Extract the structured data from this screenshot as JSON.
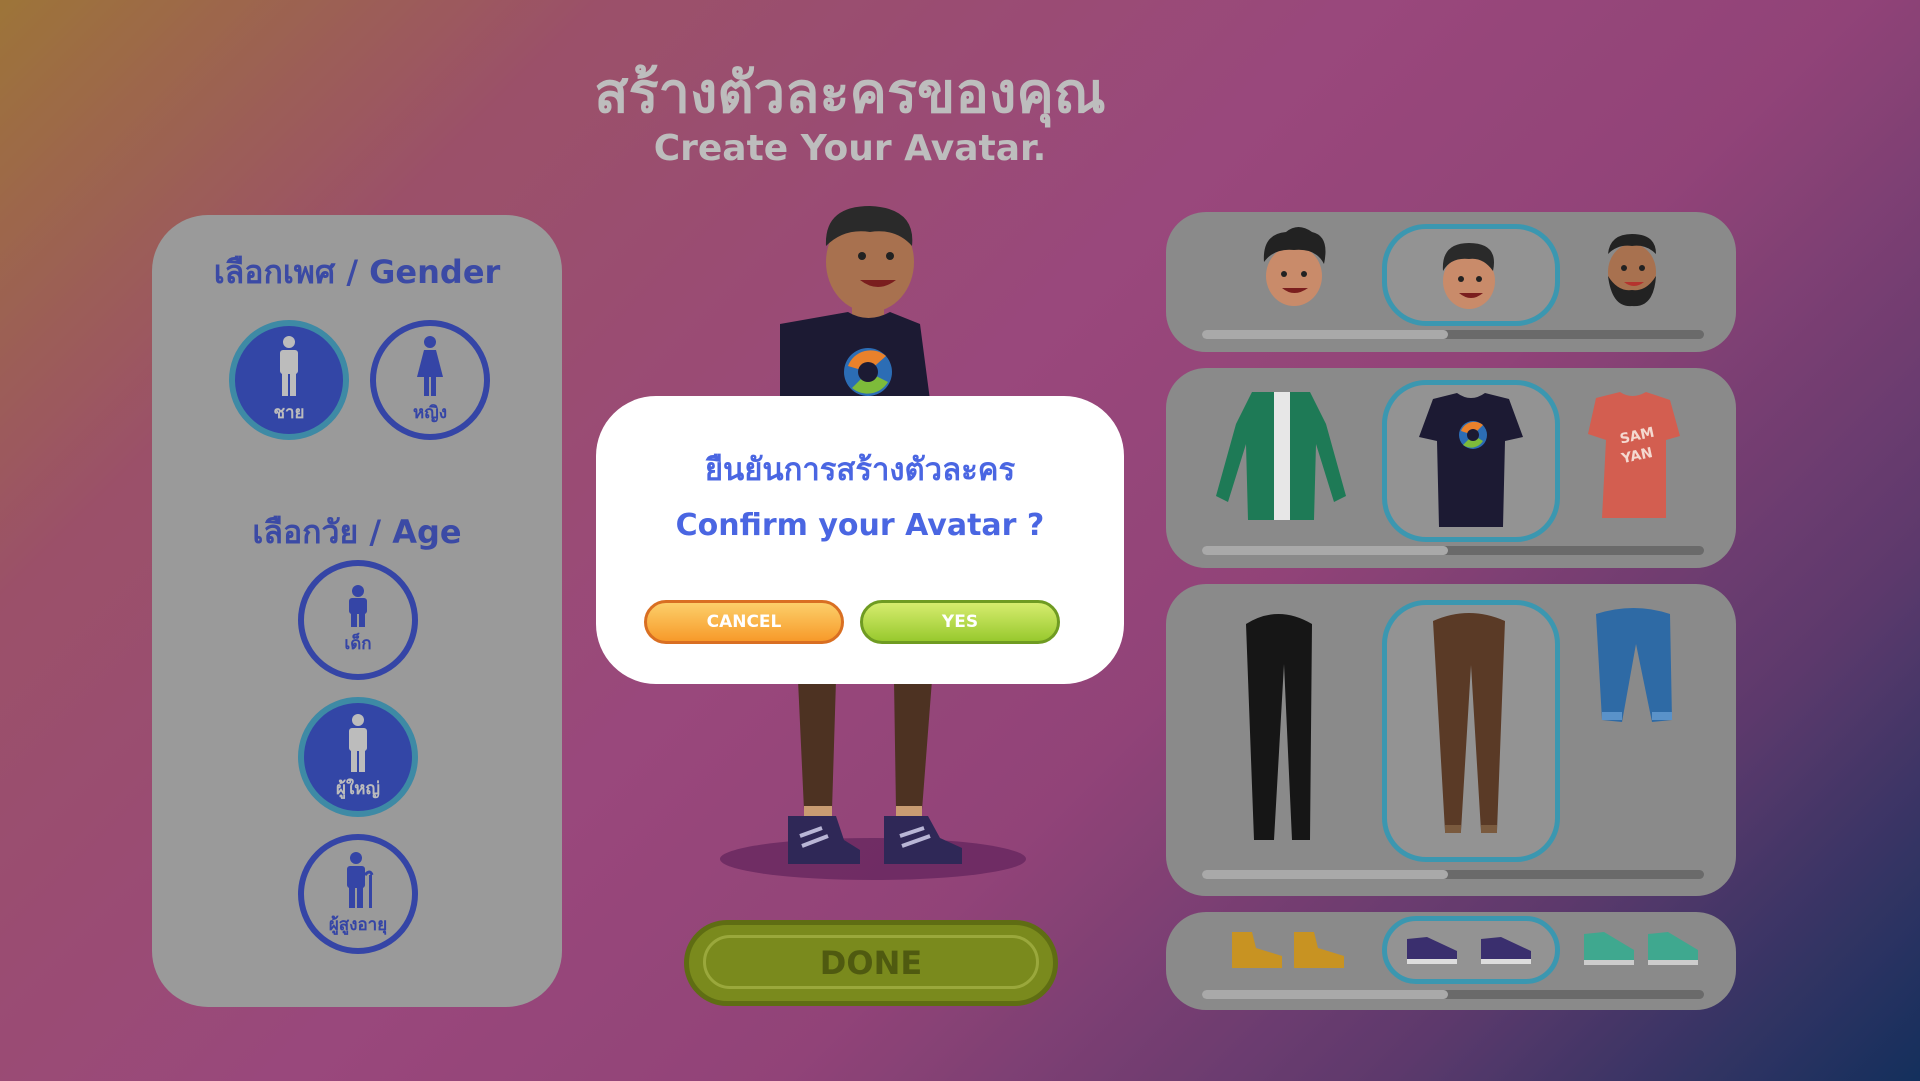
{
  "header": {
    "title_th": "สร้างตัวละครของคุณ",
    "title_en": "Create Your Avatar."
  },
  "left_panel": {
    "gender_label": "เลือกเพศ /  Gender",
    "gender_options": [
      {
        "label": "ชาย",
        "icon": "male-icon",
        "selected": true
      },
      {
        "label": "หญิง",
        "icon": "female-icon",
        "selected": false
      }
    ],
    "age_label": "เลือกวัย / Age",
    "age_options": [
      {
        "label": "เด็ก",
        "icon": "child-icon",
        "selected": false
      },
      {
        "label": "ผู้ใหญ่",
        "icon": "adult-icon",
        "selected": true
      },
      {
        "label": "ผู้สูงอายุ",
        "icon": "elderly-icon",
        "selected": false
      }
    ]
  },
  "wardrobe": {
    "heads": [
      "curly-hair-head",
      "short-hair-head",
      "bearded-head"
    ],
    "tops": [
      "green-jacket",
      "navy-logo-tshirt",
      "red-samyan-tshirt"
    ],
    "top_print": "SAM YAN",
    "bottoms": [
      "black-pants",
      "brown-pants",
      "blue-shorts"
    ],
    "shoes": [
      "yellow-boots",
      "purple-sneakers",
      "teal-sneakers"
    ],
    "selected_index": 1,
    "scroll_progress": 0.49
  },
  "modal": {
    "title_th": "ยืนยันการสร้างตัวละคร",
    "title_en": "Confirm your Avatar ?",
    "cancel_label": "CANCEL",
    "yes_label": "YES"
  },
  "done_label": "DONE",
  "colors": {
    "primary_blue": "#3545a6",
    "accent_teal": "#3b97b0",
    "modal_text": "#4a66e2",
    "cancel_orange": "#f79a2a",
    "yes_green": "#98c92e"
  }
}
